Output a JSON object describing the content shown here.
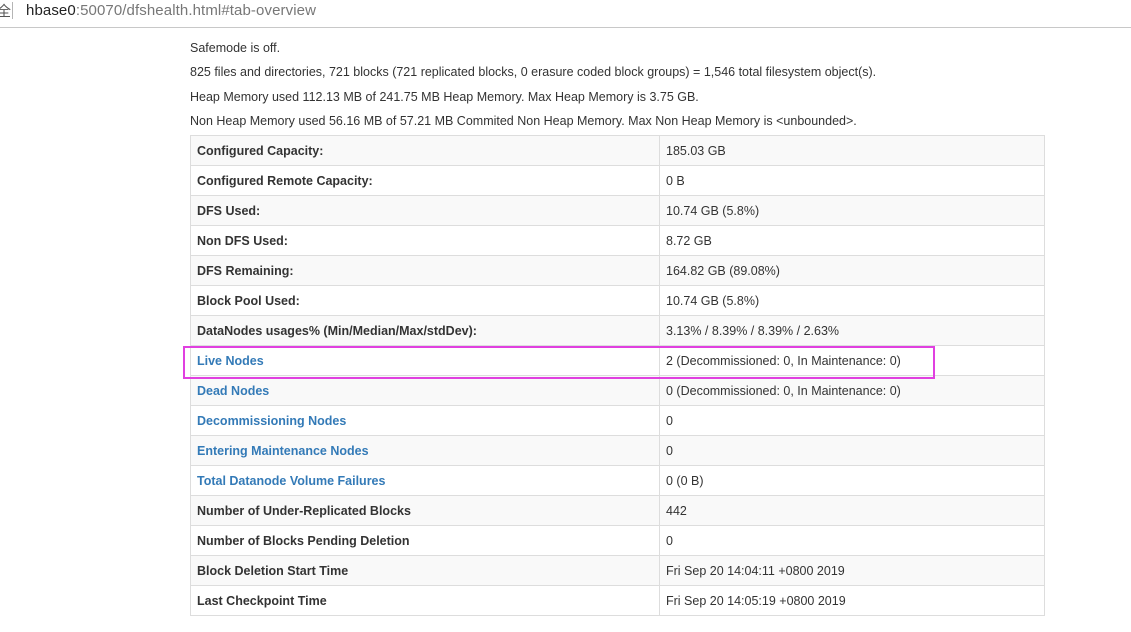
{
  "browser": {
    "security_indicator": "全",
    "url_host": "hbase0",
    "url_rest": ":50070/dfshealth.html#tab-overview"
  },
  "summary": {
    "safemode": "Safemode is off.",
    "files_blocks": "825 files and directories, 721 blocks (721 replicated blocks, 0 erasure coded block groups) = 1,546 total filesystem object(s).",
    "heap": "Heap Memory used 112.13 MB of 241.75 MB Heap Memory. Max Heap Memory is 3.75 GB.",
    "non_heap": "Non Heap Memory used 56.16 MB of 57.21 MB Commited Non Heap Memory. Max Non Heap Memory is <unbounded>."
  },
  "table": {
    "rows": [
      {
        "label": "Configured Capacity:",
        "value": "185.03 GB",
        "link": false
      },
      {
        "label": "Configured Remote Capacity:",
        "value": "0 B",
        "link": false
      },
      {
        "label": "DFS Used:",
        "value": "10.74 GB (5.8%)",
        "link": false
      },
      {
        "label": "Non DFS Used:",
        "value": "8.72 GB",
        "link": false
      },
      {
        "label": "DFS Remaining:",
        "value": "164.82 GB (89.08%)",
        "link": false
      },
      {
        "label": "Block Pool Used:",
        "value": "10.74 GB (5.8%)",
        "link": false
      },
      {
        "label": "DataNodes usages% (Min/Median/Max/stdDev):",
        "value": "3.13% / 8.39% / 8.39% / 2.63%",
        "link": false
      },
      {
        "label": "Live Nodes",
        "value": "2 (Decommissioned: 0, In Maintenance: 0)",
        "link": true
      },
      {
        "label": "Dead Nodes",
        "value": "0 (Decommissioned: 0, In Maintenance: 0)",
        "link": true
      },
      {
        "label": "Decommissioning Nodes",
        "value": "0",
        "link": true
      },
      {
        "label": "Entering Maintenance Nodes",
        "value": "0",
        "link": true
      },
      {
        "label": "Total Datanode Volume Failures",
        "value": "0 (0 B)",
        "link": true
      },
      {
        "label": "Number of Under-Replicated Blocks",
        "value": "442",
        "link": false
      },
      {
        "label": "Number of Blocks Pending Deletion",
        "value": "0",
        "link": false
      },
      {
        "label": "Block Deletion Start Time",
        "value": "Fri Sep 20 14:04:11 +0800 2019",
        "link": false
      },
      {
        "label": "Last Checkpoint Time",
        "value": "Fri Sep 20 14:05:19 +0800 2019",
        "link": false
      }
    ]
  },
  "colors": {
    "link": "#337ab7",
    "highlight": "#e040e0",
    "border": "#dddddd",
    "stripe": "#f9f9f9"
  }
}
